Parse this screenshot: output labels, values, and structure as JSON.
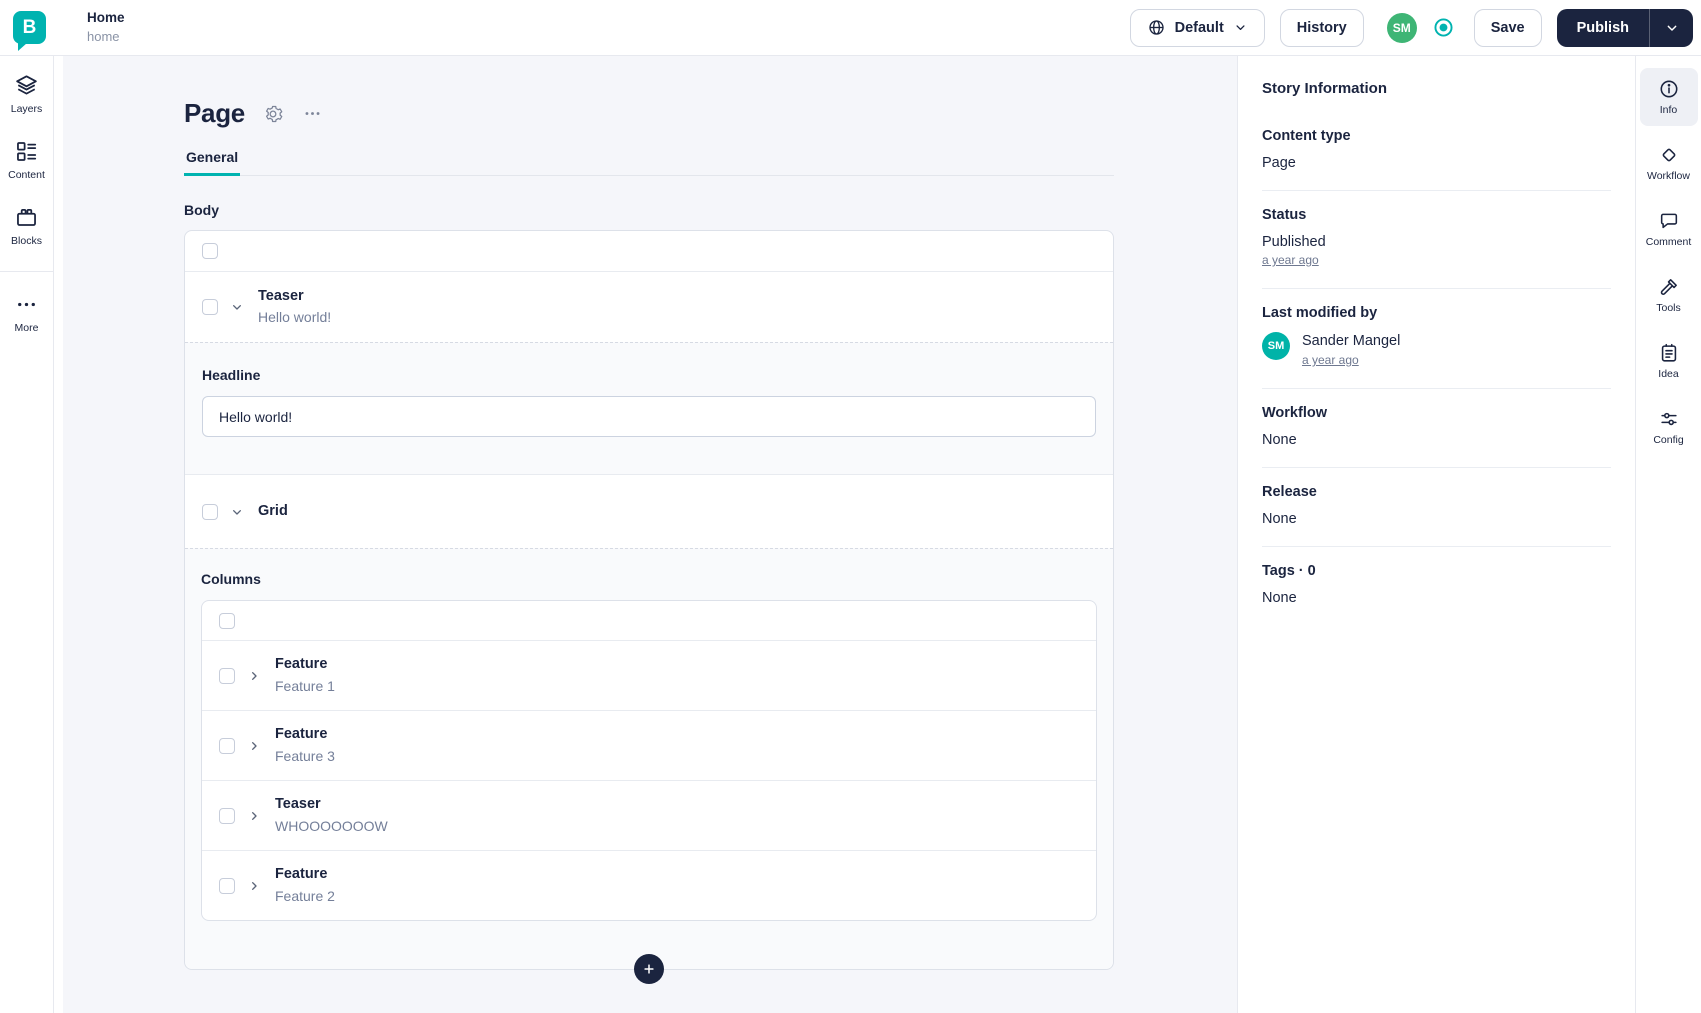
{
  "app": {
    "logo_letter": "B"
  },
  "header": {
    "story_title": "Home",
    "story_slug": "home",
    "language": "Default",
    "history": "History",
    "user_initials": "SM",
    "save": "Save",
    "publish": "Publish"
  },
  "sidebar": {
    "items": [
      {
        "label": "Layers"
      },
      {
        "label": "Content"
      },
      {
        "label": "Blocks"
      },
      {
        "label": "More"
      }
    ]
  },
  "editor": {
    "title": "Page",
    "tab": "General",
    "body": {
      "label": "Body",
      "teaser": {
        "type": "Teaser",
        "subtitle": "Hello world!",
        "field_label": "Headline",
        "field_value": "Hello world!"
      },
      "grid": {
        "type": "Grid",
        "field_label": "Columns",
        "items": [
          {
            "type": "Feature",
            "subtitle": "Feature 1"
          },
          {
            "type": "Feature",
            "subtitle": "Feature 3"
          },
          {
            "type": "Teaser",
            "subtitle": "WHOOOOOOOW"
          },
          {
            "type": "Feature",
            "subtitle": "Feature 2"
          }
        ]
      }
    }
  },
  "story_info": {
    "title": "Story Information",
    "content_type": {
      "label": "Content type",
      "value": "Page"
    },
    "status": {
      "label": "Status",
      "value": "Published",
      "time": "a year ago"
    },
    "modified": {
      "label": "Last modified by",
      "initials": "SM",
      "name": "Sander Mangel",
      "time": "a year ago"
    },
    "workflow": {
      "label": "Workflow",
      "value": "None"
    },
    "release": {
      "label": "Release",
      "value": "None"
    },
    "tags": {
      "label": "Tags · 0",
      "value": "None"
    }
  },
  "rail": {
    "items": [
      {
        "label": "Info"
      },
      {
        "label": "Workflow"
      },
      {
        "label": "Comment"
      },
      {
        "label": "Tools"
      },
      {
        "label": "Idea"
      },
      {
        "label": "Config"
      }
    ]
  },
  "colors": {
    "brand_teal": "#00b3b0",
    "navy": "#1b243f",
    "avatar_green": "#3eb575",
    "avatar_teal": "#00b3a8",
    "background": "#f5f6fa"
  }
}
